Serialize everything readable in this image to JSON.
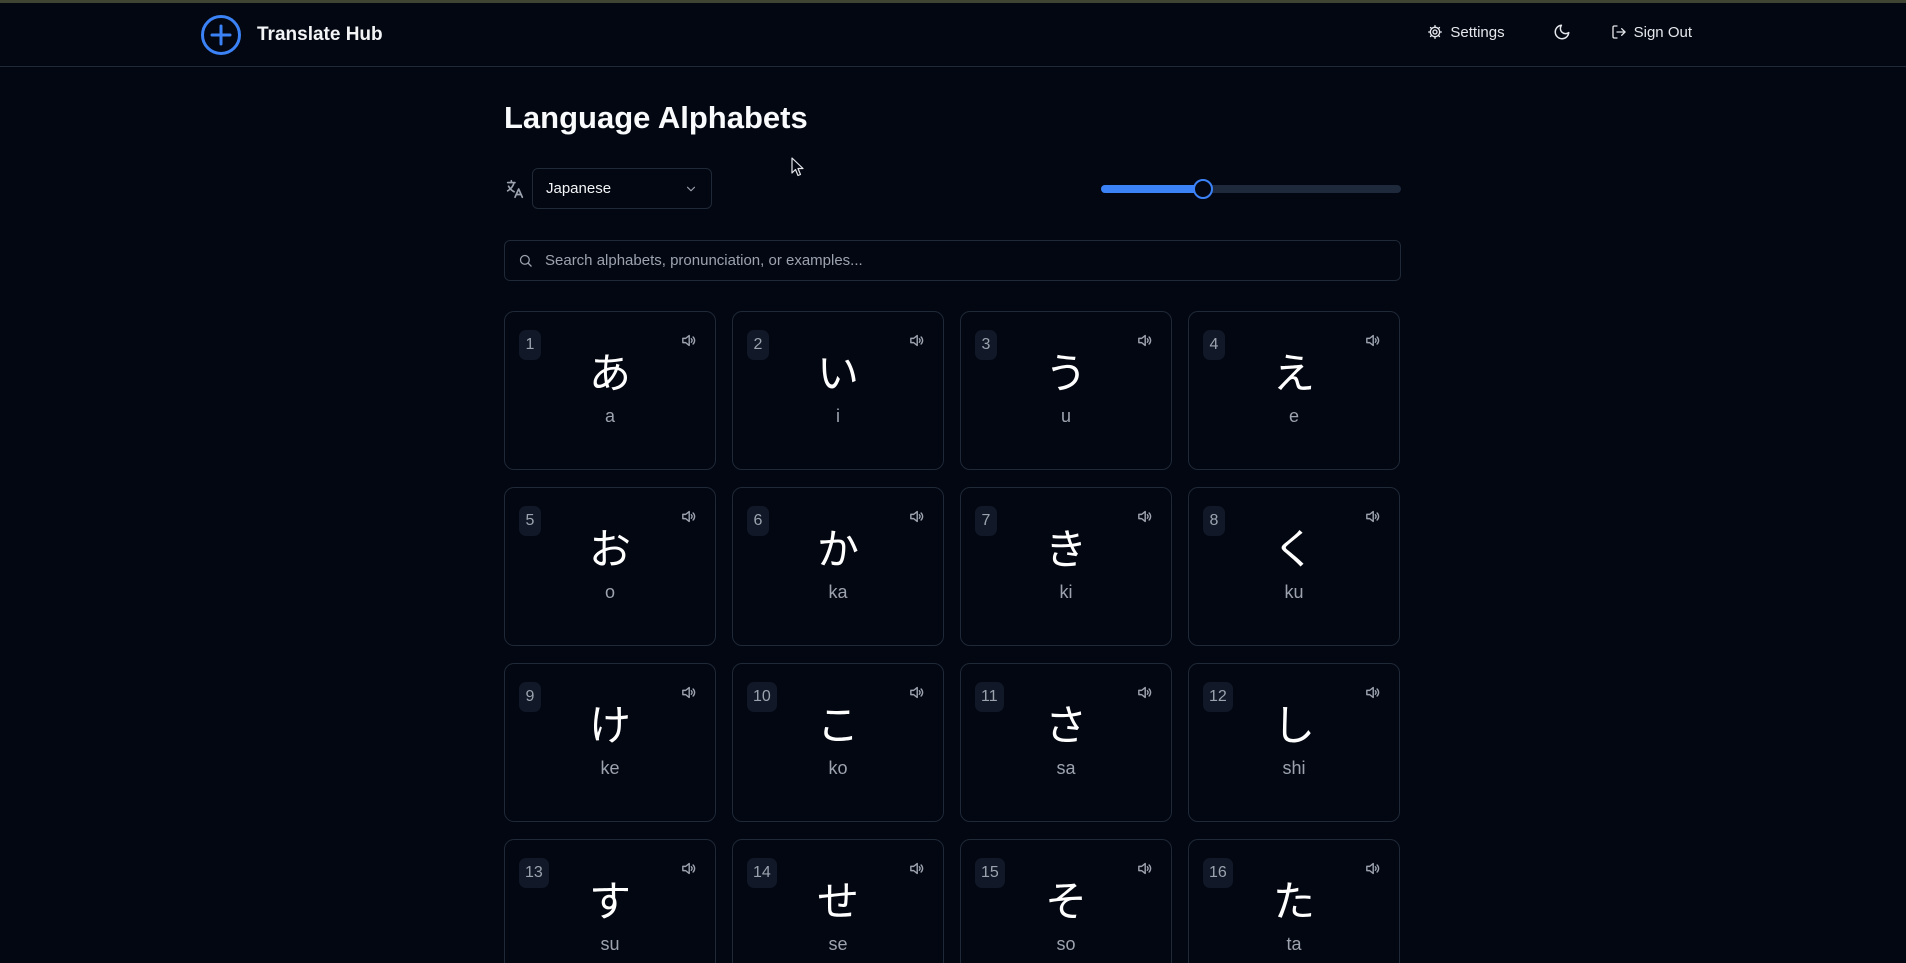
{
  "app": {
    "title": "Translate Hub"
  },
  "nav": {
    "settings_label": "Settings",
    "signout_label": "Sign Out"
  },
  "page": {
    "title": "Language Alphabets"
  },
  "language_select": {
    "selected": "Japanese"
  },
  "size_slider": {
    "value_fraction": 0.34
  },
  "search": {
    "placeholder": "Search alphabets, pronunciation, or examples..."
  },
  "cards": [
    {
      "index": "1",
      "char": "あ",
      "pron": "a"
    },
    {
      "index": "2",
      "char": "い",
      "pron": "i"
    },
    {
      "index": "3",
      "char": "う",
      "pron": "u"
    },
    {
      "index": "4",
      "char": "え",
      "pron": "e"
    },
    {
      "index": "5",
      "char": "お",
      "pron": "o"
    },
    {
      "index": "6",
      "char": "か",
      "pron": "ka"
    },
    {
      "index": "7",
      "char": "き",
      "pron": "ki"
    },
    {
      "index": "8",
      "char": "く",
      "pron": "ku"
    },
    {
      "index": "9",
      "char": "け",
      "pron": "ke"
    },
    {
      "index": "10",
      "char": "こ",
      "pron": "ko"
    },
    {
      "index": "11",
      "char": "さ",
      "pron": "sa"
    },
    {
      "index": "12",
      "char": "し",
      "pron": "shi"
    },
    {
      "index": "13",
      "char": "す",
      "pron": "su"
    },
    {
      "index": "14",
      "char": "せ",
      "pron": "se"
    },
    {
      "index": "15",
      "char": "そ",
      "pron": "so"
    },
    {
      "index": "16",
      "char": "た",
      "pron": "ta"
    }
  ],
  "colors": {
    "background": "#030712",
    "accent": "#3b82f6",
    "border": "#1f2937",
    "muted_text": "#9ca3af"
  },
  "icons": {
    "logo": "plus-circle-icon",
    "settings": "gear-icon",
    "theme": "moon-icon",
    "signout": "sign-out-icon",
    "language": "translate-icon",
    "select": "chevron-down-icon",
    "search": "search-icon",
    "card_audio": "speaker-icon"
  }
}
